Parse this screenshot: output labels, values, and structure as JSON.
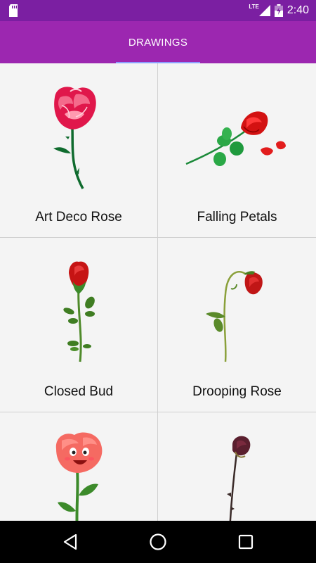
{
  "status_bar": {
    "time": "2:40",
    "network": "LTE",
    "icons": [
      "sd-card-icon",
      "signal-icon",
      "battery-charging-icon"
    ]
  },
  "app_bar": {
    "tabs": [
      {
        "label": "DRAWINGS",
        "selected": true
      }
    ],
    "indicator_color": "#8c9eff",
    "bar_color": "#9c27b0",
    "status_color": "#7b1fa2"
  },
  "drawings": [
    {
      "label": "Art Deco Rose",
      "icon": "art-deco-rose-image"
    },
    {
      "label": "Falling Petals",
      "icon": "falling-petals-image"
    },
    {
      "label": "Closed Bud",
      "icon": "closed-bud-image"
    },
    {
      "label": "Drooping Rose",
      "icon": "drooping-rose-image"
    },
    {
      "label": "",
      "icon": "cartoon-rose-image"
    },
    {
      "label": "",
      "icon": "dried-rose-image"
    }
  ],
  "nav_bar": {
    "buttons": [
      "back-icon",
      "home-icon",
      "recents-icon"
    ]
  }
}
